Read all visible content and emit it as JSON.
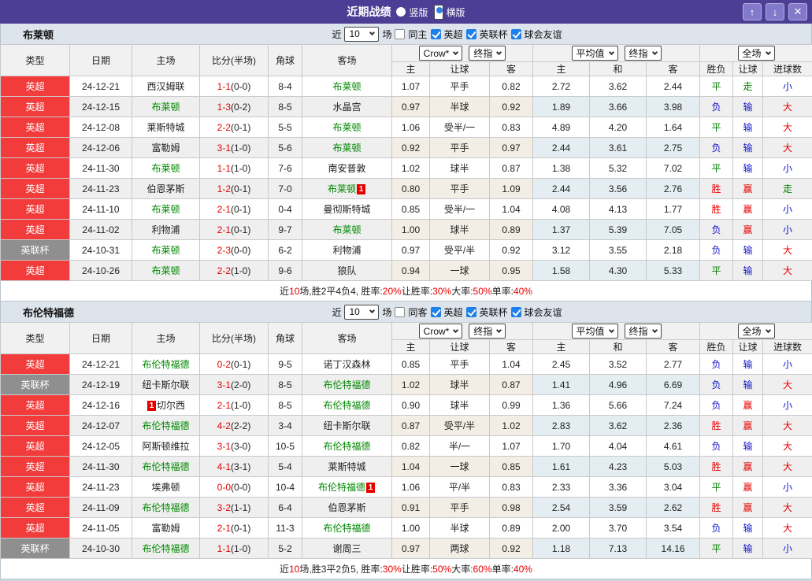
{
  "titlebar": {
    "title": "近期战绩",
    "radio_vertical": "竖版",
    "radio_horizontal": "横版",
    "selected_layout": "横版",
    "buttons": {
      "up": "↑",
      "down": "↓",
      "close": "✕"
    }
  },
  "colors": {
    "titlebar_bg": "#4b3e94",
    "titlebar_button_bg": "#8379cb",
    "type_league_red": "#f23c3c",
    "type_cup_gray": "#8f8f8f",
    "focus_team_green": "#008800",
    "score_red": "#e60000",
    "win_red": "#e60000",
    "draw_green": "#008000",
    "lose_blue": "#1414cc",
    "checkbox_blue": "#1e80e8",
    "filterbar_bg": "#dde4ec",
    "handicap_col_bg": "#fdf8ef",
    "odds_col_bg": "#edf6fb"
  },
  "filter_labels": {
    "near": "近",
    "matches_value": "10",
    "unit": "场",
    "league_checks": [
      "英超",
      "英联杯",
      "球会友谊"
    ]
  },
  "columns": {
    "left": [
      "类型",
      "日期",
      "主场",
      "比分(半场)",
      "角球",
      "客场"
    ],
    "handicap": [
      "主",
      "让球",
      "客"
    ],
    "odds": [
      "主",
      "和",
      "客"
    ],
    "result": [
      "胜负",
      "让球",
      "进球数"
    ]
  },
  "selects": {
    "handicap_source": "Crow*",
    "handicap_final": "终指",
    "odds_source": "平均值",
    "odds_final": "终指",
    "result_scope": "全场"
  },
  "tables": [
    {
      "team": "布莱顿",
      "same_label": "同主",
      "rows": [
        {
          "type": "英超",
          "tc": "red",
          "date": "24-12-21",
          "home": "西汉姆联",
          "hg": false,
          "score": "1-1",
          "half": "(0-0)",
          "corner": "8-4",
          "away": "布莱顿",
          "ag": true,
          "h1": "1.07",
          "hcap": "平手",
          "h2": "0.82",
          "o1": "2.72",
          "o2": "3.62",
          "o3": "2.44",
          "r1": "平",
          "r1c": "g",
          "r2": "走",
          "r2c": "g",
          "r3": "小",
          "r3c": "b"
        },
        {
          "type": "英超",
          "tc": "red",
          "date": "24-12-15",
          "home": "布莱顿",
          "hg": true,
          "score": "1-3",
          "half": "(0-2)",
          "corner": "8-5",
          "away": "水晶宫",
          "ag": false,
          "h1": "0.97",
          "hcap": "半球",
          "h2": "0.92",
          "o1": "1.89",
          "o2": "3.66",
          "o3": "3.98",
          "r1": "负",
          "r1c": "b",
          "r2": "输",
          "r2c": "b",
          "r3": "大",
          "r3c": "r"
        },
        {
          "type": "英超",
          "tc": "red",
          "date": "24-12-08",
          "home": "莱斯特城",
          "hg": false,
          "score": "2-2",
          "half": "(0-1)",
          "corner": "5-5",
          "away": "布莱顿",
          "ag": true,
          "h1": "1.06",
          "hcap": "受半/一",
          "h2": "0.83",
          "o1": "4.89",
          "o2": "4.20",
          "o3": "1.64",
          "r1": "平",
          "r1c": "g",
          "r2": "输",
          "r2c": "b",
          "r3": "大",
          "r3c": "r"
        },
        {
          "type": "英超",
          "tc": "red",
          "date": "24-12-06",
          "home": "富勒姆",
          "hg": false,
          "score": "3-1",
          "half": "(1-0)",
          "corner": "5-6",
          "away": "布莱顿",
          "ag": true,
          "h1": "0.92",
          "hcap": "平手",
          "h2": "0.97",
          "o1": "2.44",
          "o2": "3.61",
          "o3": "2.75",
          "r1": "负",
          "r1c": "b",
          "r2": "输",
          "r2c": "b",
          "r3": "大",
          "r3c": "r"
        },
        {
          "type": "英超",
          "tc": "red",
          "date": "24-11-30",
          "home": "布莱顿",
          "hg": true,
          "score": "1-1",
          "half": "(1-0)",
          "corner": "7-6",
          "away": "南安普敦",
          "ag": false,
          "h1": "1.02",
          "hcap": "球半",
          "h2": "0.87",
          "o1": "1.38",
          "o2": "5.32",
          "o3": "7.02",
          "r1": "平",
          "r1c": "g",
          "r2": "输",
          "r2c": "b",
          "r3": "小",
          "r3c": "b"
        },
        {
          "type": "英超",
          "tc": "red",
          "date": "24-11-23",
          "home": "伯恩茅斯",
          "hg": false,
          "score": "1-2",
          "half": "(0-1)",
          "corner": "7-0",
          "away": "布莱顿",
          "ag": true,
          "aba": "1",
          "h1": "0.80",
          "hcap": "平手",
          "h2": "1.09",
          "o1": "2.44",
          "o2": "3.56",
          "o3": "2.76",
          "r1": "胜",
          "r1c": "r",
          "r2": "赢",
          "r2c": "r",
          "r3": "走",
          "r3c": "g"
        },
        {
          "type": "英超",
          "tc": "red",
          "date": "24-11-10",
          "home": "布莱顿",
          "hg": true,
          "score": "2-1",
          "half": "(0-1)",
          "corner": "0-4",
          "away": "曼彻斯特城",
          "ag": false,
          "h1": "0.85",
          "hcap": "受半/一",
          "h2": "1.04",
          "o1": "4.08",
          "o2": "4.13",
          "o3": "1.77",
          "r1": "胜",
          "r1c": "r",
          "r2": "赢",
          "r2c": "r",
          "r3": "小",
          "r3c": "b"
        },
        {
          "type": "英超",
          "tc": "red",
          "date": "24-11-02",
          "home": "利物浦",
          "hg": false,
          "score": "2-1",
          "half": "(0-1)",
          "corner": "9-7",
          "away": "布莱顿",
          "ag": true,
          "h1": "1.00",
          "hcap": "球半",
          "h2": "0.89",
          "o1": "1.37",
          "o2": "5.39",
          "o3": "7.05",
          "r1": "负",
          "r1c": "b",
          "r2": "赢",
          "r2c": "r",
          "r3": "小",
          "r3c": "b"
        },
        {
          "type": "英联杯",
          "tc": "gray",
          "date": "24-10-31",
          "home": "布莱顿",
          "hg": true,
          "score": "2-3",
          "half": "(0-0)",
          "corner": "6-2",
          "away": "利物浦",
          "ag": false,
          "h1": "0.97",
          "hcap": "受平/半",
          "h2": "0.92",
          "o1": "3.12",
          "o2": "3.55",
          "o3": "2.18",
          "r1": "负",
          "r1c": "b",
          "r2": "输",
          "r2c": "b",
          "r3": "大",
          "r3c": "r"
        },
        {
          "type": "英超",
          "tc": "red",
          "date": "24-10-26",
          "home": "布莱顿",
          "hg": true,
          "score": "2-2",
          "half": "(1-0)",
          "corner": "9-6",
          "away": "狼队",
          "ag": false,
          "h1": "0.94",
          "hcap": "一球",
          "h2": "0.95",
          "o1": "1.58",
          "o2": "4.30",
          "o3": "5.33",
          "r1": "平",
          "r1c": "g",
          "r2": "输",
          "r2c": "b",
          "r3": "大",
          "r3c": "r"
        }
      ],
      "summary": [
        [
          "近",
          "k"
        ],
        [
          "10",
          "r"
        ],
        [
          "场,胜2平4负4, 胜率:",
          "k"
        ],
        [
          "20%",
          "r"
        ],
        [
          " 让胜率:",
          "k"
        ],
        [
          "30%",
          "r"
        ],
        [
          " 大率:",
          "k"
        ],
        [
          "50%",
          "r"
        ],
        [
          " 单率:",
          "k"
        ],
        [
          "40%",
          "r"
        ]
      ]
    },
    {
      "team": "布伦特福德",
      "same_label": "同客",
      "rows": [
        {
          "type": "英超",
          "tc": "red",
          "date": "24-12-21",
          "home": "布伦特福德",
          "hg": true,
          "score": "0-2",
          "half": "(0-1)",
          "corner": "9-5",
          "away": "诺丁汉森林",
          "ag": false,
          "h1": "0.85",
          "hcap": "平手",
          "h2": "1.04",
          "o1": "2.45",
          "o2": "3.52",
          "o3": "2.77",
          "r1": "负",
          "r1c": "b",
          "r2": "输",
          "r2c": "b",
          "r3": "小",
          "r3c": "b"
        },
        {
          "type": "英联杯",
          "tc": "gray",
          "date": "24-12-19",
          "home": "纽卡斯尔联",
          "hg": false,
          "score": "3-1",
          "half": "(2-0)",
          "corner": "8-5",
          "away": "布伦特福德",
          "ag": true,
          "h1": "1.02",
          "hcap": "球半",
          "h2": "0.87",
          "o1": "1.41",
          "o2": "4.96",
          "o3": "6.69",
          "r1": "负",
          "r1c": "b",
          "r2": "输",
          "r2c": "b",
          "r3": "大",
          "r3c": "r"
        },
        {
          "type": "英超",
          "tc": "red",
          "date": "24-12-16",
          "home": "切尔西",
          "hg": false,
          "hbb": "1",
          "score": "2-1",
          "half": "(1-0)",
          "corner": "8-5",
          "away": "布伦特福德",
          "ag": true,
          "h1": "0.90",
          "hcap": "球半",
          "h2": "0.99",
          "o1": "1.36",
          "o2": "5.66",
          "o3": "7.24",
          "r1": "负",
          "r1c": "b",
          "r2": "赢",
          "r2c": "r",
          "r3": "小",
          "r3c": "b"
        },
        {
          "type": "英超",
          "tc": "red",
          "date": "24-12-07",
          "home": "布伦特福德",
          "hg": true,
          "score": "4-2",
          "half": "(2-2)",
          "corner": "3-4",
          "away": "纽卡斯尔联",
          "ag": false,
          "h1": "0.87",
          "hcap": "受平/半",
          "h2": "1.02",
          "o1": "2.83",
          "o2": "3.62",
          "o3": "2.36",
          "r1": "胜",
          "r1c": "r",
          "r2": "赢",
          "r2c": "r",
          "r3": "大",
          "r3c": "r"
        },
        {
          "type": "英超",
          "tc": "red",
          "date": "24-12-05",
          "home": "阿斯顿维拉",
          "hg": false,
          "score": "3-1",
          "half": "(3-0)",
          "corner": "10-5",
          "away": "布伦特福德",
          "ag": true,
          "h1": "0.82",
          "hcap": "半/一",
          "h2": "1.07",
          "o1": "1.70",
          "o2": "4.04",
          "o3": "4.61",
          "r1": "负",
          "r1c": "b",
          "r2": "输",
          "r2c": "b",
          "r3": "大",
          "r3c": "r"
        },
        {
          "type": "英超",
          "tc": "red",
          "date": "24-11-30",
          "home": "布伦特福德",
          "hg": true,
          "score": "4-1",
          "half": "(3-1)",
          "corner": "5-4",
          "away": "莱斯特城",
          "ag": false,
          "h1": "1.04",
          "hcap": "一球",
          "h2": "0.85",
          "o1": "1.61",
          "o2": "4.23",
          "o3": "5.03",
          "r1": "胜",
          "r1c": "r",
          "r2": "赢",
          "r2c": "r",
          "r3": "大",
          "r3c": "r"
        },
        {
          "type": "英超",
          "tc": "red",
          "date": "24-11-23",
          "home": "埃弗顿",
          "hg": false,
          "score": "0-0",
          "half": "(0-0)",
          "corner": "10-4",
          "away": "布伦特福德",
          "ag": true,
          "aba": "1",
          "h1": "1.06",
          "hcap": "平/半",
          "h2": "0.83",
          "o1": "2.33",
          "o2": "3.36",
          "o3": "3.04",
          "r1": "平",
          "r1c": "g",
          "r2": "赢",
          "r2c": "r",
          "r3": "小",
          "r3c": "b"
        },
        {
          "type": "英超",
          "tc": "red",
          "date": "24-11-09",
          "home": "布伦特福德",
          "hg": true,
          "score": "3-2",
          "half": "(1-1)",
          "corner": "6-4",
          "away": "伯恩茅斯",
          "ag": false,
          "h1": "0.91",
          "hcap": "平手",
          "h2": "0.98",
          "o1": "2.54",
          "o2": "3.59",
          "o3": "2.62",
          "r1": "胜",
          "r1c": "r",
          "r2": "赢",
          "r2c": "r",
          "r3": "大",
          "r3c": "r"
        },
        {
          "type": "英超",
          "tc": "red",
          "date": "24-11-05",
          "home": "富勒姆",
          "hg": false,
          "score": "2-1",
          "half": "(0-1)",
          "corner": "11-3",
          "away": "布伦特福德",
          "ag": true,
          "h1": "1.00",
          "hcap": "半球",
          "h2": "0.89",
          "o1": "2.00",
          "o2": "3.70",
          "o3": "3.54",
          "r1": "负",
          "r1c": "b",
          "r2": "输",
          "r2c": "b",
          "r3": "大",
          "r3c": "r"
        },
        {
          "type": "英联杯",
          "tc": "gray",
          "date": "24-10-30",
          "home": "布伦特福德",
          "hg": true,
          "score": "1-1",
          "half": "(1-0)",
          "corner": "5-2",
          "away": "谢周三",
          "ag": false,
          "h1": "0.97",
          "hcap": "两球",
          "h2": "0.92",
          "o1": "1.18",
          "o2": "7.13",
          "o3": "14.16",
          "r1": "平",
          "r1c": "g",
          "r2": "输",
          "r2c": "b",
          "r3": "小",
          "r3c": "b"
        }
      ],
      "summary": [
        [
          "近",
          "k"
        ],
        [
          "10",
          "r"
        ],
        [
          "场,胜3平2负5, 胜率:",
          "k"
        ],
        [
          "30%",
          "r"
        ],
        [
          " 让胜率:",
          "k"
        ],
        [
          "50%",
          "r"
        ],
        [
          " 大率:",
          "k"
        ],
        [
          "60%",
          "r"
        ],
        [
          " 单率:",
          "k"
        ],
        [
          "40%",
          "r"
        ]
      ]
    }
  ]
}
